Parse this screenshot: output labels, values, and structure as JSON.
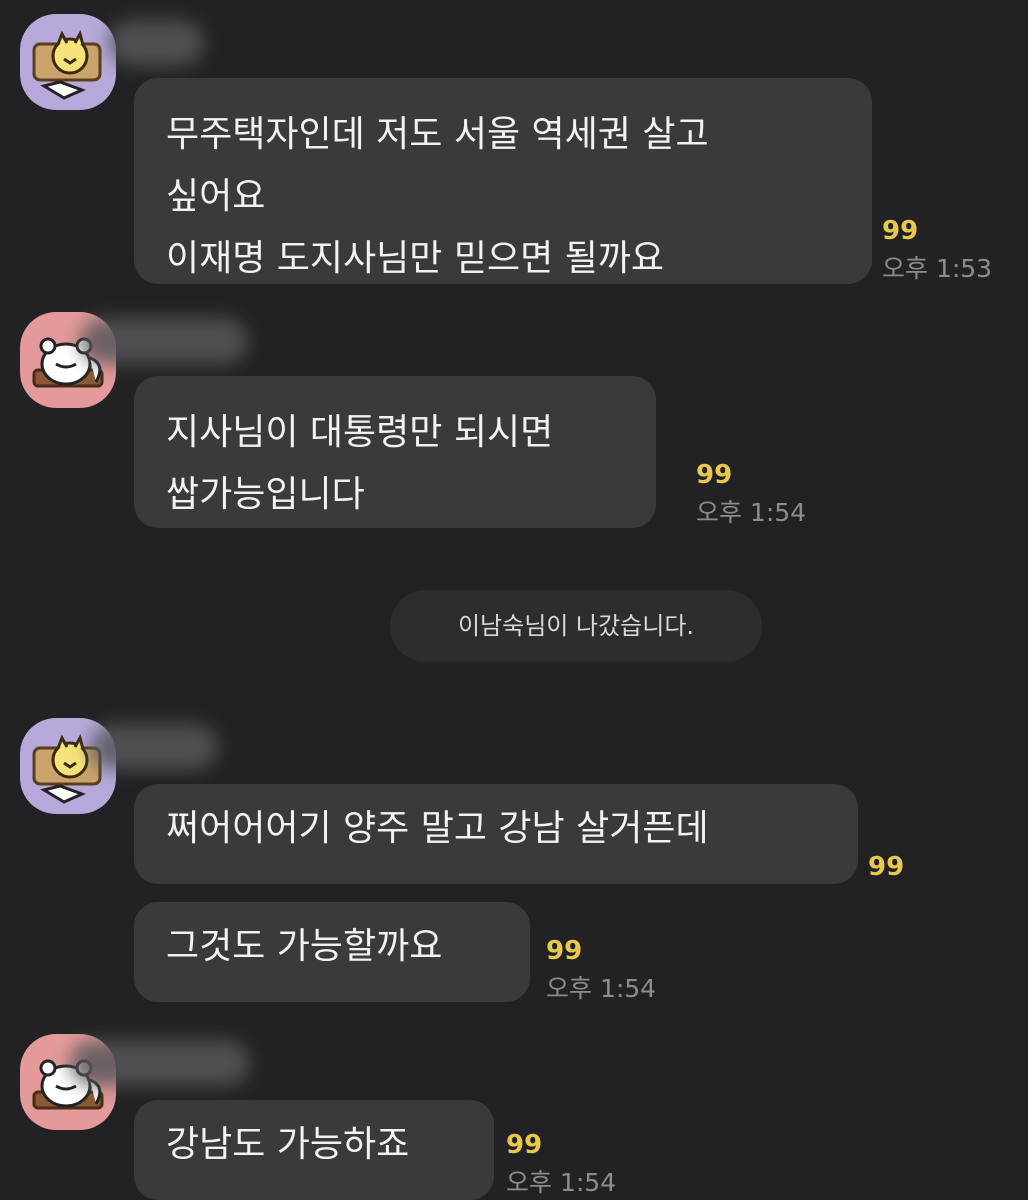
{
  "messages": [
    {
      "lines": [
        "무주택자인데 저도 서울 역세권 살고",
        "싶어요",
        "이재명 도지사님만 믿으면 될까요"
      ],
      "unread": "99",
      "time": "오후 1:53"
    },
    {
      "lines": [
        "지사님이 대통령만 되시면",
        "쌉가능입니다"
      ],
      "unread": "99",
      "time": "오후 1:54"
    },
    {
      "lines": [
        "쩌어어어기 양주 말고 강남 살거픈데"
      ],
      "unread": "99"
    },
    {
      "lines": [
        "그것도 가능할까요"
      ],
      "unread": "99",
      "time": "오후 1:54"
    },
    {
      "lines": [
        "강남도 가능하죠"
      ],
      "unread": "99",
      "time": "오후 1:54"
    }
  ],
  "system_notice": "이남숙님이 나갔습니다.",
  "colors": {
    "background": "#222224",
    "bubble": "#3a3a3d",
    "unread": "#e8c84d",
    "avatar_purple": "#b7aadb",
    "avatar_pink": "#e49a9a"
  }
}
